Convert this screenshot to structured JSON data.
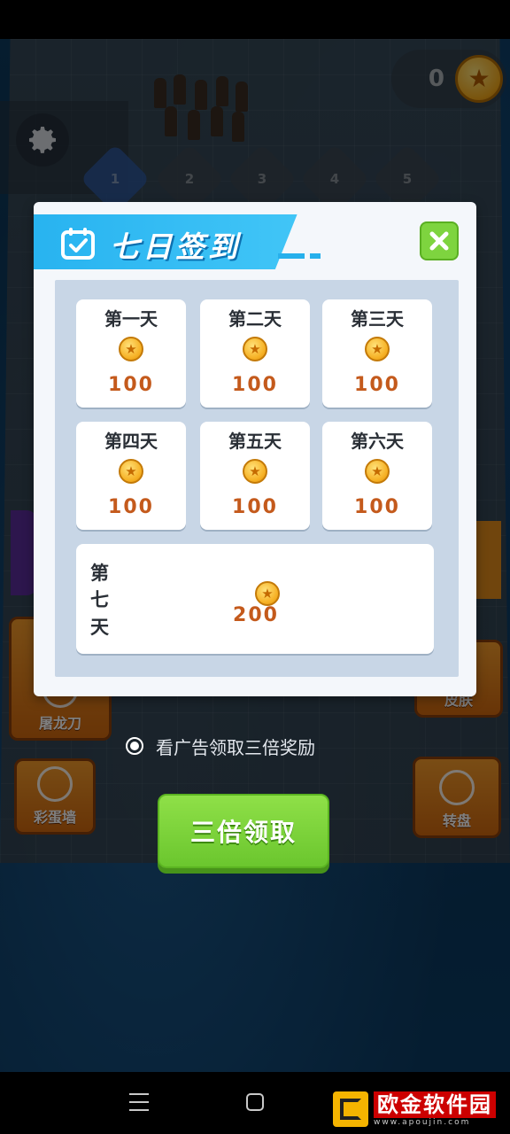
{
  "hud": {
    "coin_count": "0",
    "level_nodes": [
      "1",
      "2",
      "3",
      "4",
      "5"
    ]
  },
  "side_menu": {
    "dragon_blade": "屠龙刀",
    "egg_wall": "彩蛋墙",
    "skin": "皮肤",
    "wheel": "转盘"
  },
  "dialog": {
    "title": "七日签到",
    "days": [
      {
        "name": "第一天",
        "amount": "100"
      },
      {
        "name": "第二天",
        "amount": "100"
      },
      {
        "name": "第三天",
        "amount": "100"
      },
      {
        "name": "第四天",
        "amount": "100"
      },
      {
        "name": "第五天",
        "amount": "100"
      },
      {
        "name": "第六天",
        "amount": "100"
      }
    ],
    "day7": {
      "name": "第七天",
      "amount": "200"
    }
  },
  "triple_option": {
    "label": "看广告领取三倍奖励",
    "selected": true
  },
  "claim_button": {
    "label": "三倍领取"
  },
  "watermark": {
    "main": "欧金软件园",
    "sub": "www.apoujin.com"
  },
  "colors": {
    "header_blue": "#28b3f0",
    "close_green": "#7ed43f",
    "claim_green": "#6bc62e",
    "amount_orange": "#c45a1c",
    "coin_gold": "#f6b125"
  }
}
